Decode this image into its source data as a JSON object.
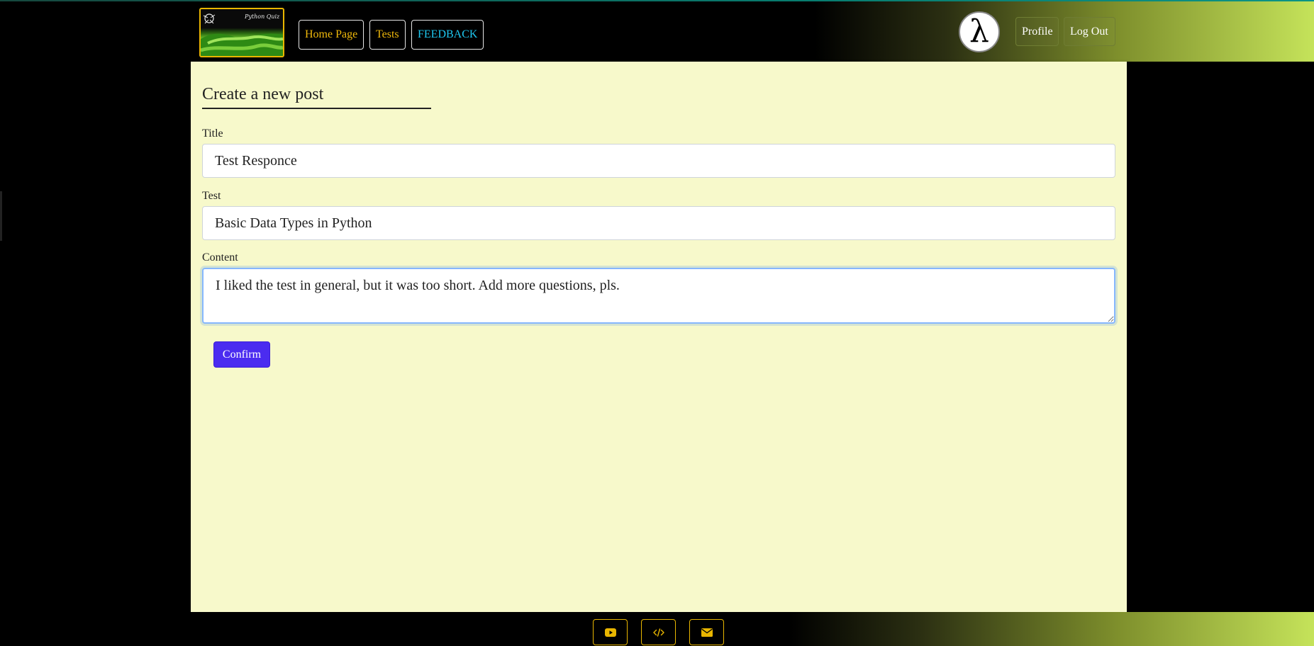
{
  "header": {
    "logo_text": "Python Quiz",
    "nav": {
      "home": "Home Page",
      "tests": "Tests",
      "feedback": "FEEDBACK"
    },
    "avatar_glyph": "λ",
    "profile": "Profile",
    "logout": "Log Out"
  },
  "form": {
    "heading": "Create a new post",
    "title_label": "Title",
    "title_value": "Test Responce",
    "test_label": "Test",
    "test_value": "Basic Data Types in Python",
    "content_label": "Content",
    "content_value": "I liked the test in general, but it was too short. Add more questions, pls.",
    "confirm": "Confirm"
  },
  "footer": {
    "icons": [
      "youtube-icon",
      "code-icon",
      "envelope-icon"
    ]
  },
  "colors": {
    "accent_yellow": "#f0b90b",
    "feedback_cyan": "#1ec8f0",
    "confirm_button": "#4b2cf0",
    "page_background": "#f7f9cb",
    "gradient_green": "#c5e35a"
  }
}
